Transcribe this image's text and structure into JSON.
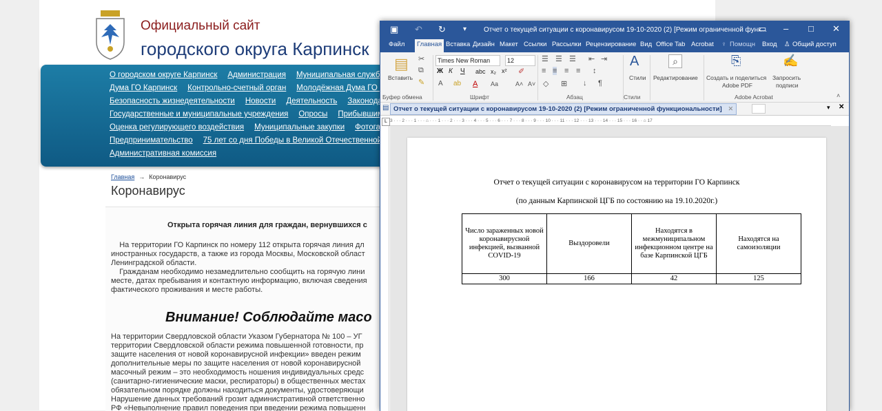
{
  "site": {
    "title_line1": "Официальный сайт",
    "title_line2": "городского округа Карпинск",
    "nav_rows": [
      [
        "О городском округе Карпинск",
        "Администрация",
        "Муниципальная служба"
      ],
      [
        "Дума ГО Карпинск",
        "Контрольно-счетный орган",
        "Молодёжная Дума ГО К"
      ],
      [
        "Безопасность жизнедеятельности",
        "Новости",
        "Деятельность",
        "Законода"
      ],
      [
        "Государственные и муниципальные учреждения",
        "Опросы",
        "Прибывшим"
      ],
      [
        "Оценка регулирующего воздействия",
        "Муниципальные закупки",
        "Фотогал"
      ],
      [
        "Предпринимательство",
        "75 лет со дня Победы в Великой Отечественной в"
      ],
      [
        "Административная комиссия"
      ]
    ],
    "breadcrumb": {
      "home": "Главная",
      "separator": "→",
      "current": "Коронавирус"
    },
    "page_title": "Коронавирус",
    "hotline_title": "Открыта горячая линия для граждан, вернувшихся с",
    "paragraph1": [
      "    На территории ГО Карпинск по номеру 112 открыта горячая линия дл",
      "иностранных государств, а также из города Москвы, Московской област",
      "Ленинградской области."
    ],
    "paragraph2": [
      "    Гражданам необходимо незамедлительно сообщить на горячую лини",
      "месте, датах пребывания и контактную информацию, включая сведения",
      "фактического проживания и месте работы."
    ],
    "attention_heading": "Внимание! Соблюдайте масо",
    "paragraph3": [
      "На территории Свердловской области Указом Губернатора № 100 – УГ",
      "территории Свердловской области режима повышенной готовности, пр",
      "защите населения от новой коронавирусной инфекции» введен режим",
      "дополнительные меры по защите населения от новой коронавирусной",
      "масочный режим – это необходимость ношения индивидуальных средс",
      "(санитарно-гигиенические маски, респираторы) в общественных местах",
      "обязательном порядке должны находиться документы, удостоверяющи",
      "Нарушение данных требований грозит административной ответственно",
      "РФ «Невыполнение правил поведения при введении режима повышенн"
    ]
  },
  "word": {
    "window_title": "Отчет о текущей ситуации с коронавирусом 19-10-2020 (2) [Режим ограниченной функ...",
    "tabs": [
      "Файл",
      "Главная",
      "Вставка",
      "Дизайн",
      "Макет",
      "Ссылки",
      "Рассылки",
      "Рецензирование",
      "Вид",
      "Office Tab",
      "Acrobat",
      "Помощн",
      "Вход",
      "Общий доступ"
    ],
    "ribbon": {
      "paste": "Вставить",
      "font_name": "Times New Roman",
      "font_size": "12",
      "styles": "Стили",
      "editing": "Редактирование",
      "create_share": "Создать и поделиться",
      "create_share2": "Adobe PDF",
      "request_sign": "Запросить",
      "request_sign2": "подписи",
      "groups": [
        "Буфер обмена",
        "Шрифт",
        "Абзац",
        "Стили",
        "Adobe Acrobat"
      ]
    },
    "doc_tab": "Отчет о текущей ситуации с коронавирусом 19-10-2020 (2) [Режим ограниченной функциональности]",
    "ruler_text": "3 · · · 2 · · · 1 · · · ⌂ · · · 1 · · · 2 · · · 3 · · · 4 · · · 5 · · · 6 · · · 7 · · · 8 · · · 9 · · · 10 · · · 11 · · · 12 · · · 13 · · · 14 · · · 15 · · · 16 · · ⌂ 17",
    "document": {
      "title": "Отчет о текущей ситуации с коронавирусом на территории ГО Карпинск",
      "subtitle": "(по данным Карпинской ЦГБ по состоянию на 19.10.2020г.)",
      "table": {
        "headers": [
          "Число зараженных новой коронавирусной инфекцией, вызванной COVID-19",
          "Выздоровели",
          "Находятся в межмуниципальном инфекционном центре на базе Карпинской ЦГБ",
          "Находятся на самоизоляции"
        ],
        "values": [
          "300",
          "166",
          "42",
          "125"
        ]
      }
    }
  }
}
